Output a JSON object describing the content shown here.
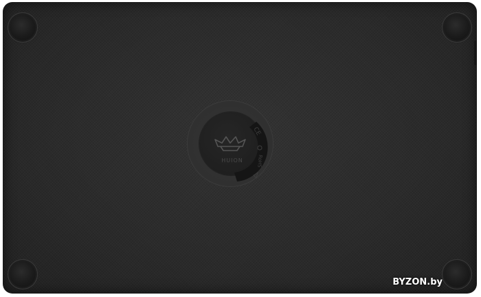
{
  "product": {
    "brand_text": "HUION"
  },
  "label_marks": {
    "rohs": "RoHS",
    "ce": "CE"
  },
  "watermark": {
    "text": "BYZON.by"
  },
  "colors": {
    "body": "#2b2b2b",
    "feet": "#1b1b1b",
    "label_ring": "#353535",
    "label_center": "#1c1c1c"
  }
}
